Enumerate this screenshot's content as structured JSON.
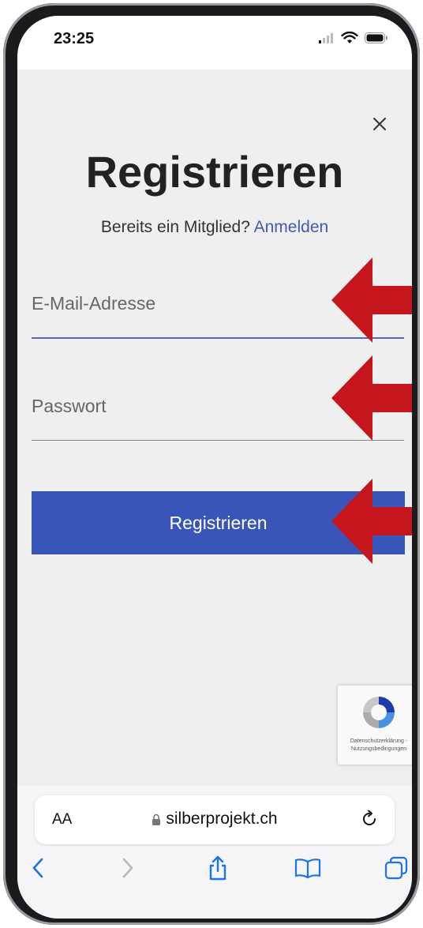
{
  "status_bar": {
    "time": "23:25"
  },
  "form": {
    "title": "Registrieren",
    "member_prompt": "Bereits ein Mitglied?",
    "login_link": "Anmelden",
    "email_placeholder": "E-Mail-Adresse",
    "password_placeholder": "Passwort",
    "submit_label": "Registrieren"
  },
  "recaptcha": {
    "privacy": "Datenschutzerklärung -",
    "terms": "Nutzungsbedingungen"
  },
  "browser": {
    "aa_label": "AA",
    "url": "silberprojekt.ch"
  },
  "colors": {
    "accent": "#3a55b9",
    "link": "#3f5bb7",
    "arrow": "#c4161c",
    "ios_blue": "#1a73e8"
  },
  "icons": [
    "wifi-icon",
    "battery-icon",
    "close-icon",
    "lock-icon",
    "reload-icon",
    "back-icon",
    "forward-icon",
    "share-icon",
    "bookmarks-icon",
    "tabs-icon",
    "recaptcha-logo-icon",
    "red-arrow-icon"
  ]
}
